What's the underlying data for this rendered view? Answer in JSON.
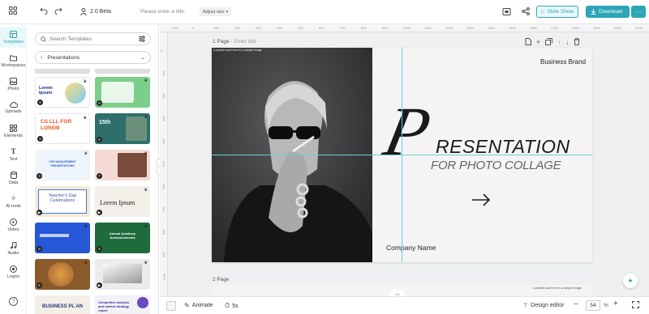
{
  "app": {
    "version": "2.0 Beta",
    "title_placeholder": "Please enter a title.",
    "adjust_size": "Adjust size"
  },
  "toolbar": {
    "slide_show": "Slide Show",
    "download": "Download"
  },
  "rail": [
    {
      "label": "Templates"
    },
    {
      "label": "Workspaces"
    },
    {
      "label": "Photo"
    },
    {
      "label": "Uploads"
    },
    {
      "label": "Elements"
    },
    {
      "label": "Text"
    },
    {
      "label": "Data"
    },
    {
      "label": "AI tools"
    },
    {
      "label": "Video"
    },
    {
      "label": "Audio"
    },
    {
      "label": "Logos"
    }
  ],
  "panel": {
    "search_placeholder": "Search Templates",
    "category": "Presentations",
    "thumbs": [
      {
        "num": "9",
        "text": "Lorem Ipsum",
        "bg": "#ffffff"
      },
      {
        "num": "8",
        "text": "",
        "bg": "#7ccf8a"
      },
      {
        "num": "9",
        "text": "CS LLL FOR LOREM",
        "bg": "#ffffff"
      },
      {
        "num": "8",
        "text": "15th",
        "bg": "#2e6f6a"
      },
      {
        "num": "9",
        "text": "CSS MANAGEMENT PRESENTATIONS",
        "bg": "#eef5fb"
      },
      {
        "num": "7",
        "text": "",
        "bg": "#f4d9d4"
      },
      {
        "num": "",
        "text": "Teacher's Day Celebrations",
        "bg": "#f6e9d6"
      },
      {
        "num": "",
        "text": "Lorem Ipsum",
        "bg": "#f2efe9"
      },
      {
        "num": "9",
        "text": "",
        "bg": "#2557d6"
      },
      {
        "num": "9",
        "text": "Annual Academy Announcements",
        "bg": "#1f6b3e"
      },
      {
        "num": "6",
        "text": "",
        "bg": "#8a5a2b"
      },
      {
        "num": "",
        "text": "",
        "bg": "#ececec"
      },
      {
        "num": "",
        "text": "BUSINESS PL AN",
        "bg": "#f3efe7"
      },
      {
        "num": "",
        "text": "Competitor analysis and market strategy report",
        "bg": "#f1f1f6"
      }
    ]
  },
  "canvas": {
    "page1_label": "1 Page",
    "page1_placeholder": "Enter title",
    "page2_label": "2 Page",
    "brand": "Business Brand",
    "title_big_letter": "P",
    "title_rest": "RESENTATION",
    "subtitle": "FOR PHOTO COLLAGE",
    "company": "Company Name",
    "photo_caption": "A portrait used here is a sample image",
    "page2_caption": "A portrait used here is a sample image"
  },
  "bottom": {
    "animate": "Animate",
    "duration": "5s",
    "design_editor": "Design editor",
    "zoom": "54",
    "zoom_unit": "%"
  },
  "ruler": {
    "top": [
      "-100",
      "0",
      "100",
      "200",
      "300",
      "400",
      "500",
      "600",
      "700",
      "800",
      "900",
      "1000",
      "1100",
      "1200",
      "1300",
      "1400",
      "1500",
      "1600",
      "1700",
      "1800",
      "1900",
      "2000",
      "2100"
    ],
    "left": [
      "0",
      "100",
      "200",
      "300",
      "400",
      "500",
      "600",
      "700",
      "800",
      "900",
      "1000",
      "1100"
    ]
  },
  "colors": {
    "accent": "#2aa6b6",
    "guide": "#5fd3e0"
  }
}
